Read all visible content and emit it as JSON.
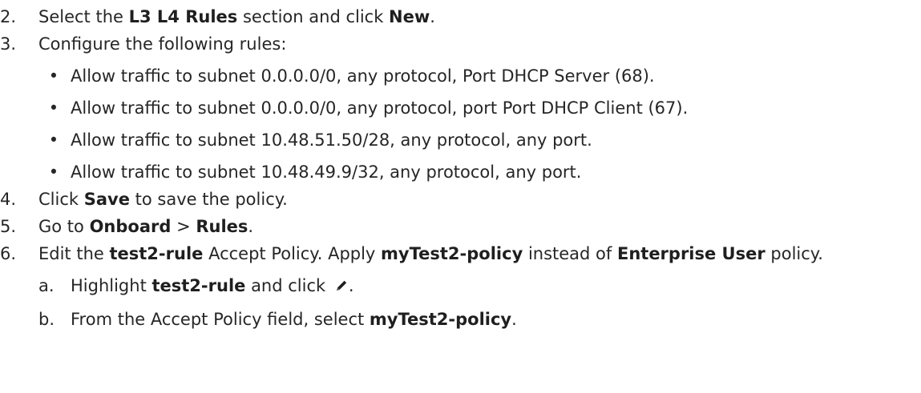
{
  "steps": [
    {
      "number": "2.",
      "parts": [
        "Select the ",
        "L3 L4 Rules",
        " section and click ",
        "New",
        "."
      ]
    },
    {
      "number": "3.",
      "text": "Configure the following rules:",
      "bullets": [
        "Allow traffic to subnet 0.0.0.0/0, any protocol, Port DHCP Server (68).",
        "Allow traffic to subnet 0.0.0.0/0, any protocol, port Port DHCP Client (67).",
        "Allow traffic to subnet 10.48.51.50/28, any protocol, any port.",
        "Allow traffic to subnet 10.48.49.9/32, any protocol, any port."
      ]
    },
    {
      "number": "4.",
      "parts": [
        "Click ",
        "Save",
        " to save the policy."
      ]
    },
    {
      "number": "5.",
      "parts": [
        "Go to ",
        "Onboard",
        " > ",
        "Rules",
        "."
      ]
    },
    {
      "number": "6.",
      "parts": [
        "Edit the ",
        "test2-rule",
        " Accept Policy. Apply ",
        "myTest2-policy",
        " instead of ",
        "Enterprise User",
        " policy."
      ],
      "substeps": [
        {
          "letter": "a.",
          "parts": [
            "Highlight ",
            "test2-rule",
            " and click ",
            "."
          ]
        },
        {
          "letter": "b.",
          "parts": [
            "From the Accept Policy field, select ",
            "myTest2-policy",
            "."
          ]
        }
      ]
    }
  ],
  "bullet_char": "•",
  "edit_icon": "pencil-icon"
}
